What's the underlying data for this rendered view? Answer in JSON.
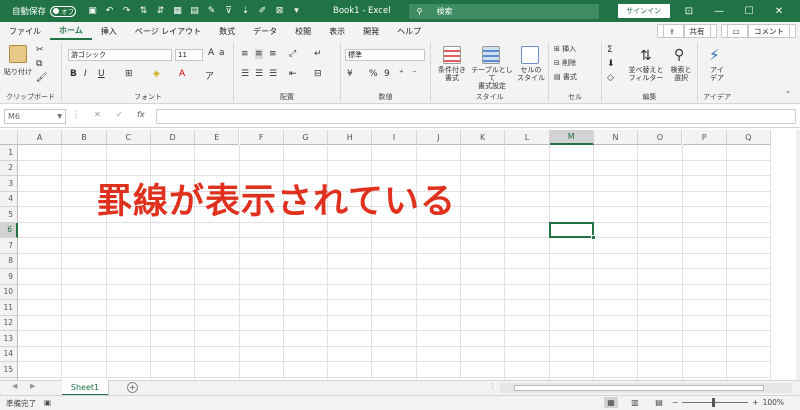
{
  "titlebar": {
    "autosave_label": "自動保存",
    "autosave_state": "オフ",
    "doc_title": "Book1 - Excel",
    "search_placeholder": "検索",
    "signin_label": "サインイン"
  },
  "tabs": [
    {
      "label": "ファイル",
      "active": false
    },
    {
      "label": "ホーム",
      "active": true
    },
    {
      "label": "挿入",
      "active": false
    },
    {
      "label": "ページ レイアウト",
      "active": false
    },
    {
      "label": "数式",
      "active": false
    },
    {
      "label": "データ",
      "active": false
    },
    {
      "label": "校閲",
      "active": false
    },
    {
      "label": "表示",
      "active": false
    },
    {
      "label": "開発",
      "active": false
    },
    {
      "label": "ヘルプ",
      "active": false
    }
  ],
  "tabs_right": {
    "share": "共有",
    "comment": "コメント"
  },
  "ribbon": {
    "clipboard": {
      "group": "クリップボード",
      "paste": "貼り付け"
    },
    "font": {
      "group": "フォント",
      "name": "游ゴシック",
      "size": "11"
    },
    "alignment": {
      "group": "配置"
    },
    "number": {
      "group": "数値",
      "format": "標準"
    },
    "styles": {
      "group": "スタイル",
      "conditional_1": "条件付き",
      "conditional_2": "書式",
      "table_1": "テーブルとして",
      "table_2": "書式設定",
      "cell_1": "セルの",
      "cell_2": "スタイル"
    },
    "cells": {
      "group": "セル",
      "insert": "挿入",
      "delete": "削除",
      "format": "書式"
    },
    "editing": {
      "group": "編集",
      "sort_1": "並べ替えと",
      "sort_2": "フィルター",
      "find_1": "検索と",
      "find_2": "選択"
    },
    "ideas": {
      "group": "アイデア",
      "label_1": "アイ",
      "label_2": "デア"
    }
  },
  "formula_bar": {
    "name_box": "M6",
    "formula": ""
  },
  "grid": {
    "columns": [
      "A",
      "B",
      "C",
      "D",
      "E",
      "F",
      "G",
      "H",
      "I",
      "J",
      "K",
      "L",
      "M",
      "N",
      "O",
      "P",
      "Q"
    ],
    "rows": [
      "1",
      "2",
      "3",
      "4",
      "5",
      "6",
      "7",
      "8",
      "9",
      "10",
      "11",
      "12",
      "13",
      "14",
      "15",
      "16"
    ],
    "selected_column": "M",
    "selected_row": "6",
    "selected_cell": "M6"
  },
  "annotation": "罫線が表示されている",
  "sheet_tabs": [
    "Sheet1"
  ],
  "status": {
    "ready": "準備完了",
    "zoom": "100%"
  },
  "colors": {
    "accent": "#217346",
    "annotation": "#e0301e"
  }
}
